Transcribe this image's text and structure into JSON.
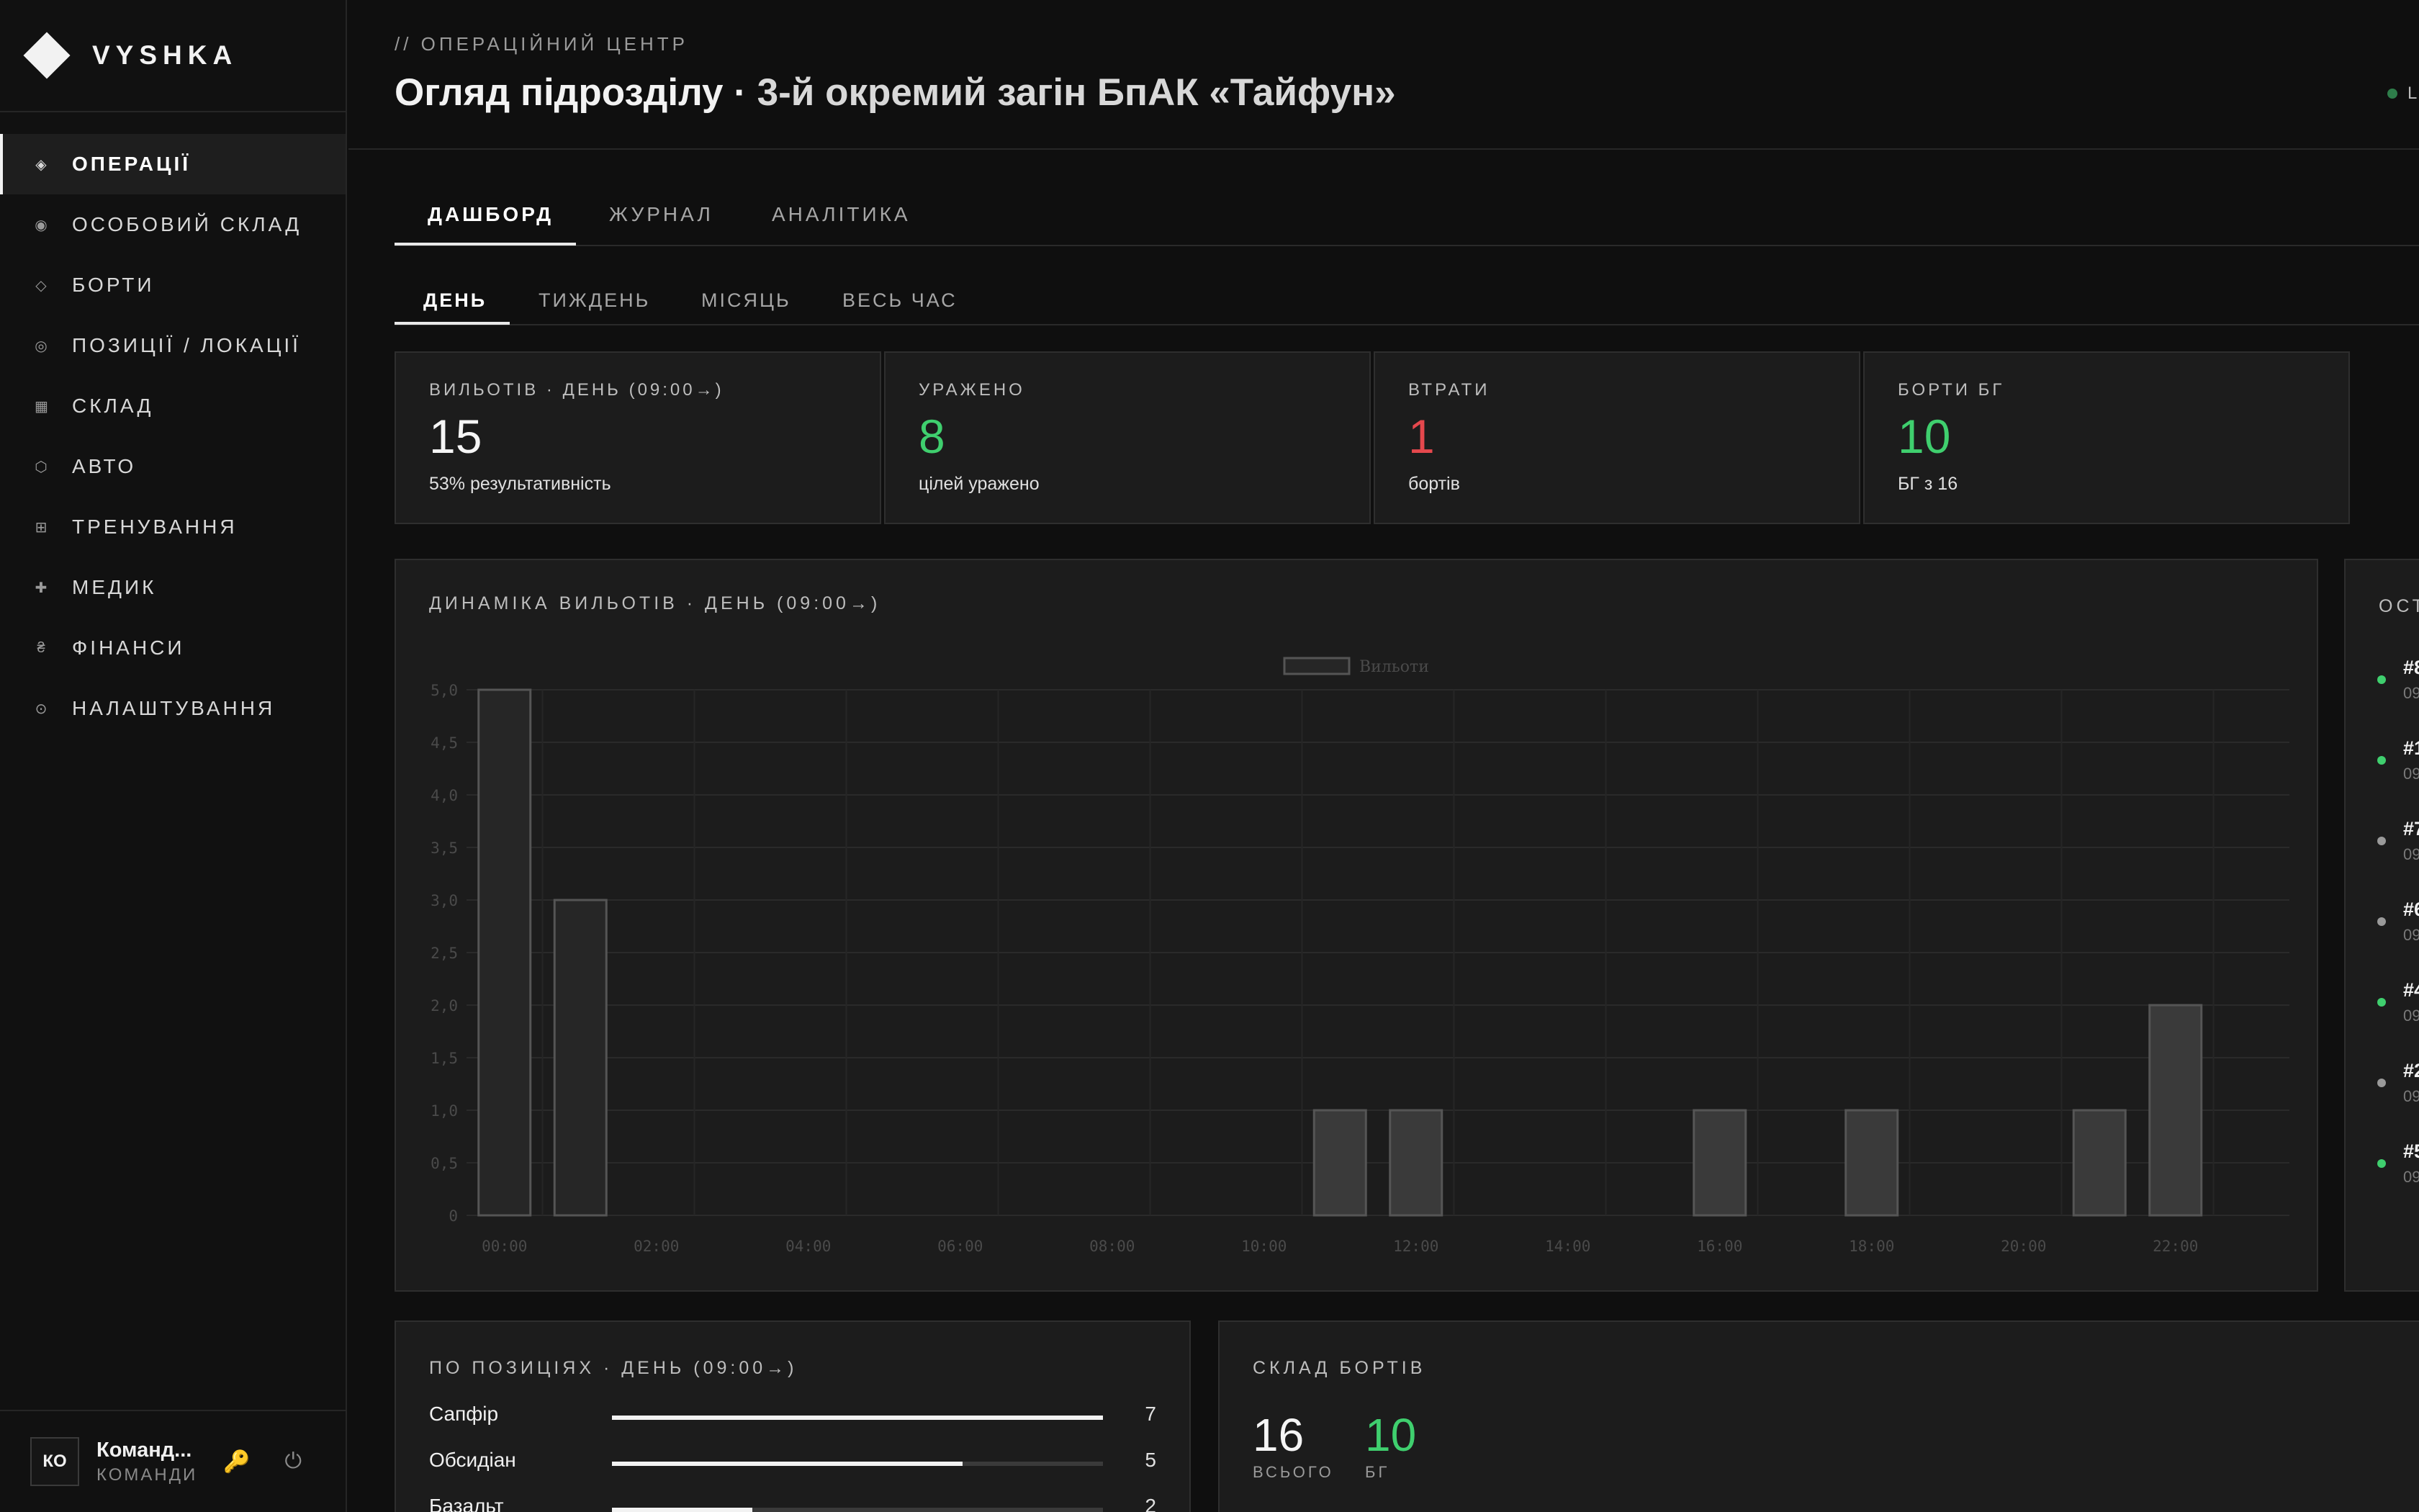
{
  "brand": {
    "name": "VYSHKA"
  },
  "sidebar": {
    "items": [
      {
        "label": "ОПЕРАЦІЇ",
        "icon": "◈",
        "active": true
      },
      {
        "label": "ОСОБОВИЙ СКЛАД",
        "icon": "◉"
      },
      {
        "label": "БОРТИ",
        "icon": "◇"
      },
      {
        "label": "ПОЗИЦІЇ / ЛОКАЦІЇ",
        "icon": "◎"
      },
      {
        "label": "СКЛАД",
        "icon": "▦"
      },
      {
        "label": "АВТО",
        "icon": "⬡"
      },
      {
        "label": "ТРЕНУВАННЯ",
        "icon": "⊞"
      },
      {
        "label": "МЕДИК",
        "icon": "✚"
      },
      {
        "label": "ФІНАНСИ",
        "icon": "₴"
      },
      {
        "label": "НАЛАШТУВАННЯ",
        "icon": "⊙"
      }
    ]
  },
  "user": {
    "initials": "КО",
    "name": "Команд...",
    "role": "КОМАНДИ"
  },
  "header": {
    "eyebrow": "// ОПЕРАЦІЙНИЙ ЦЕНТР",
    "title_prefix": "Огляд підрозділу · ",
    "title_unit": "3-й окремий загін БпАК «Тайфун»",
    "live_label": "L"
  },
  "tabs": [
    "ДАШБОРД",
    "ЖУРНАЛ",
    "АНАЛІТИКА"
  ],
  "subtabs": [
    "ДЕНЬ",
    "ТИЖДЕНЬ",
    "МІСЯЦЬ",
    "ВЕСЬ ЧАС"
  ],
  "kpis": [
    {
      "label": "ВИЛЬОТІВ · ДЕНЬ (09:00→)",
      "value": "15",
      "sub": "53% результативність",
      "color": "#f5f5f5"
    },
    {
      "label": "УРАЖЕНО",
      "value": "8",
      "sub": "цілей уражено",
      "color": "#3fcf6e"
    },
    {
      "label": "ВТРАТИ",
      "value": "1",
      "sub": "бортів",
      "color": "#e5484d"
    },
    {
      "label": "БОРТИ БГ",
      "value": "10",
      "sub": "БГ з 16",
      "color": "#3fcf6e"
    }
  ],
  "chart_panel": {
    "title": "ДИНАМІКА ВИЛЬОТІВ · ДЕНЬ (09:00→)"
  },
  "chart_data": {
    "type": "bar",
    "legend": [
      "Вильоти"
    ],
    "legend_position": "top-center",
    "categories": [
      "00:00",
      "01:00",
      "02:00",
      "03:00",
      "04:00",
      "05:00",
      "06:00",
      "07:00",
      "08:00",
      "09:00",
      "10:00",
      "11:00",
      "12:00",
      "13:00",
      "14:00",
      "15:00",
      "16:00",
      "17:00",
      "18:00",
      "19:00",
      "20:00",
      "21:00",
      "22:00",
      "23:00"
    ],
    "tick_labels": [
      "00:00",
      "02:00",
      "04:00",
      "06:00",
      "08:00",
      "10:00",
      "12:00",
      "14:00",
      "16:00",
      "18:00",
      "20:00",
      "22:00"
    ],
    "series": [
      {
        "name": "Вильоти",
        "values": [
          5,
          3,
          0,
          0,
          0,
          0,
          0,
          0,
          0,
          0,
          0,
          1,
          1,
          0,
          0,
          0,
          1,
          0,
          1,
          0,
          0,
          1,
          2,
          0
        ]
      }
    ],
    "ylim": [
      0,
      5
    ],
    "yticks": [
      "0",
      "0,5",
      "1,0",
      "1,5",
      "2,0",
      "2,5",
      "3,0",
      "3,5",
      "4,0",
      "4,5",
      "5,0"
    ],
    "grid": true
  },
  "recent": {
    "title": "ОСТ",
    "items": [
      {
        "id": "#8",
        "time": "09",
        "color": "#3fcf6e"
      },
      {
        "id": "#1",
        "time": "09",
        "color": "#3fcf6e"
      },
      {
        "id": "#7",
        "time": "09",
        "color": "#9a9a9a"
      },
      {
        "id": "#6",
        "time": "09",
        "color": "#9a9a9a"
      },
      {
        "id": "#4",
        "time": "09",
        "color": "#3fcf6e"
      },
      {
        "id": "#2",
        "time": "09",
        "color": "#9a9a9a"
      },
      {
        "id": "#5",
        "time": "09",
        "color": "#3fcf6e"
      }
    ]
  },
  "positions": {
    "title": "ПО ПОЗИЦІЯХ · ДЕНЬ (09:00→)",
    "max": 7,
    "items": [
      {
        "name": "Сапфір",
        "value": 7
      },
      {
        "name": "Обсидіан",
        "value": 5
      },
      {
        "name": "Базальт",
        "value": 2
      }
    ]
  },
  "fleet": {
    "title": "СКЛАД БОРТІВ",
    "total_value": "16",
    "total_label": "ВСЬОГО",
    "ready_value": "10",
    "ready_label": "БГ"
  }
}
